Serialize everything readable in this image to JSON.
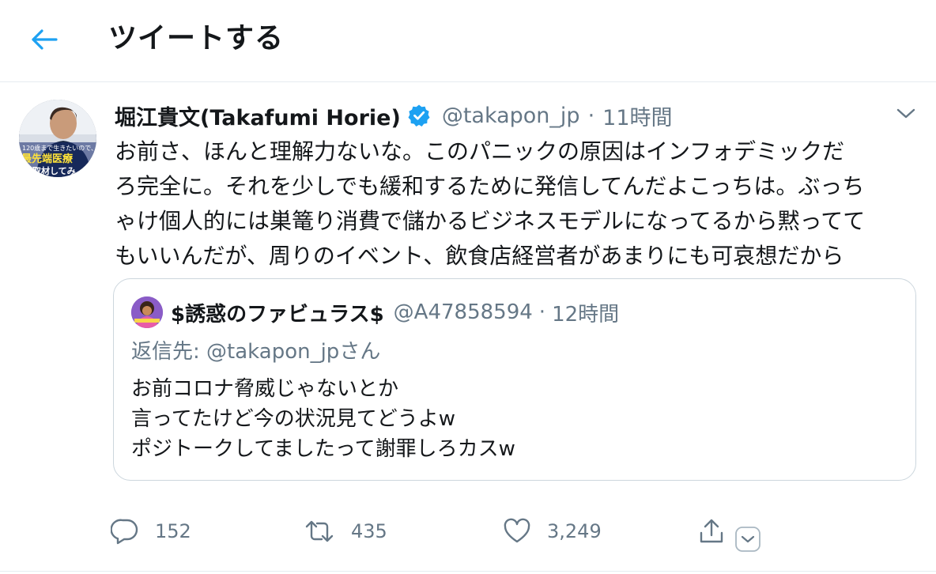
{
  "header": {
    "back_icon": "arrow-left-icon",
    "title": "ツイートする"
  },
  "tweet": {
    "author": {
      "display_name": "堀江貴文(Takafumi Horie)",
      "handle": "@takapon_jp",
      "verified": true
    },
    "separator": "·",
    "time": "11時間",
    "body_lines": [
      "お前さ、ほんと理解力ないな。このパニックの原因はインフォデミックだ",
      "ろ完全に。それを少しでも緩和するために発信してんだよこっちは。ぶっち",
      "ゃけ個人的には巣篭り消費で儲かるビジネスモデルになってるから黙ってて",
      "もいいんだが、周りのイベント、飲食店経営者があまりにも可哀想だから"
    ],
    "avatar_text": {
      "line1": "120歳まで生きたいので、",
      "line2": "最先端医療",
      "line3": "を取材してみ"
    },
    "quoted": {
      "display_name": "$誘惑のファビュラス$",
      "handle": "@A47858594",
      "separator": "·",
      "time": "12時間",
      "reply_prefix": "返信先: ",
      "reply_handle": "@takapon_jp",
      "reply_suffix": "さん",
      "body_lines": [
        "お前コロナ脅威じゃないとか",
        "言ってたけど今の状況見てどうよw",
        "ポジトークしてましたって謝罪しろカスw"
      ]
    },
    "actions": {
      "reply_count": "152",
      "retweet_count": "435",
      "like_count": "3,249"
    }
  },
  "colors": {
    "accent": "#1da1f2",
    "text": "#14171a",
    "muted": "#657786",
    "border": "#ccd6dd",
    "verified": "#1da1f2"
  }
}
